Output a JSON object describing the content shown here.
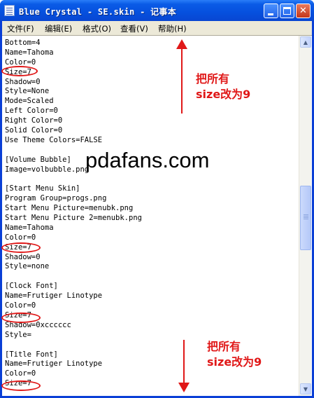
{
  "window": {
    "title": "Blue Crystal - SE.skin - 记事本",
    "buttons": {
      "minimize": "minimize",
      "maximize": "maximize",
      "close": "✕"
    }
  },
  "menubar": {
    "items": [
      "文件(F)",
      "编辑(E)",
      "格式(O)",
      "查看(V)",
      "帮助(H)"
    ]
  },
  "editor": {
    "lines": [
      "Bottom=4",
      "Name=Tahoma",
      "Color=0",
      "Size=7",
      "Shadow=0",
      "Style=None",
      "Mode=Scaled",
      "Left Color=0",
      "Right Color=0",
      "Solid Color=0",
      "Use Theme Colors=FALSE",
      "",
      "[Volume Bubble]",
      "Image=volbubble.png",
      "",
      "[Start Menu Skin]",
      "Program Group=progs.png",
      "Start Menu Picture=menubk.png",
      "Start Menu Picture 2=menubk.png",
      "Name=Tahoma",
      "Color=0",
      "Size=7",
      "Shadow=0",
      "Style=none",
      "",
      "[Clock Font]",
      "Name=Frutiger Linotype",
      "Color=0",
      "Size=7",
      "Shadow=0xcccccc",
      "Style=",
      "",
      "[Title Font]",
      "Name=Frutiger Linotype",
      "Color=0",
      "Size=7"
    ]
  },
  "annotations": {
    "note_top": [
      "把所有",
      "size改为9"
    ],
    "note_bottom": [
      "把所有",
      "size改为9"
    ],
    "watermark": "pdafans.com",
    "highlight_color": "#e01818"
  },
  "scrollbar": {
    "up_arrow": "▲",
    "down_arrow": "▼"
  },
  "colors": {
    "titlebar": "#0a5be6",
    "menubar": "#ece9d8",
    "close_button": "#c4361b",
    "annotation": "#e01818"
  }
}
